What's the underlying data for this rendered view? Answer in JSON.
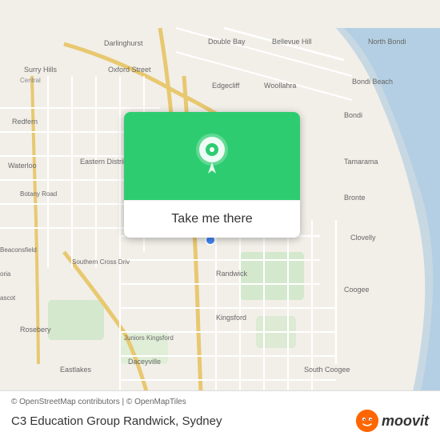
{
  "map": {
    "attribution": "© OpenStreetMap contributors | © OpenMapTiles",
    "center_location": "Randwick, Sydney",
    "background_color": "#f2efe9"
  },
  "card": {
    "button_label": "Take me there",
    "pin_color": "#2ecc71"
  },
  "bottom_bar": {
    "attribution": "© OpenStreetMap contributors | © OpenMapTiles",
    "place_name": "C3 Education Group Randwick, Sydney",
    "moovit_label": "moovit"
  },
  "icons": {
    "pin": "location-pin-icon",
    "moovit_face": "moovit-face-icon"
  }
}
